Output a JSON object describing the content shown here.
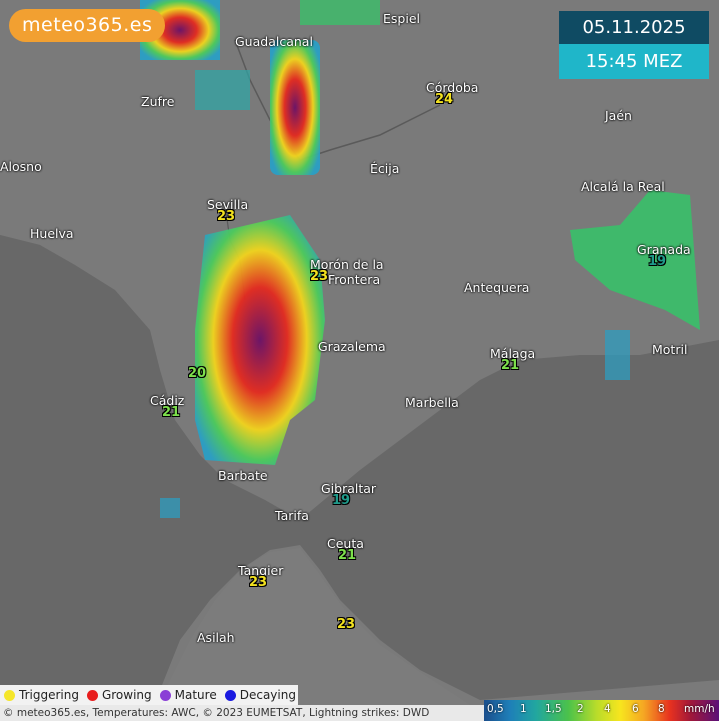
{
  "logo": "meteo365.es",
  "date": "05.11.2025",
  "time": "15:45 MEZ",
  "colors": {
    "land": "#7a7a7a",
    "sea": "#6a6a6a",
    "logo": "#f2a031",
    "date_bg": "#0f4b63",
    "time_bg": "#1fb6c9"
  },
  "cities": [
    {
      "name": "Espiel"
    },
    {
      "name": "Guadalcanal"
    },
    {
      "name": "Córdoba"
    },
    {
      "name": "Zufre"
    },
    {
      "name": "Jaén"
    },
    {
      "name": "Alosno"
    },
    {
      "name": "Écija"
    },
    {
      "name": "Sevilla"
    },
    {
      "name": "Alcalá la Real"
    },
    {
      "name": "Huelva"
    },
    {
      "name": "Granada"
    },
    {
      "name": "Morón de la"
    },
    {
      "name": "Frontera"
    },
    {
      "name": "Antequera"
    },
    {
      "name": "Grazalema"
    },
    {
      "name": "Málaga"
    },
    {
      "name": "Motril"
    },
    {
      "name": "Cádiz"
    },
    {
      "name": "Marbella"
    },
    {
      "name": "Barbate"
    },
    {
      "name": "Gibraltar"
    },
    {
      "name": "Tarifa"
    },
    {
      "name": "Ceuta"
    },
    {
      "name": "Tangier"
    },
    {
      "name": "Asilah"
    }
  ],
  "temps": [
    {
      "value": "24"
    },
    {
      "value": "23"
    },
    {
      "value": "19"
    },
    {
      "value": "23"
    },
    {
      "value": "21"
    },
    {
      "value": "20"
    },
    {
      "value": "21"
    },
    {
      "value": "19"
    },
    {
      "value": "21"
    },
    {
      "value": "23"
    },
    {
      "value": "23"
    }
  ],
  "legend": [
    {
      "label": "Triggering",
      "color": "#f5e62a"
    },
    {
      "label": "Growing",
      "color": "#e81e1e"
    },
    {
      "label": "Mature",
      "color": "#8a3fd6"
    },
    {
      "label": "Decaying",
      "color": "#1a1ae0"
    }
  ],
  "credits": "© meteo365.es, Temperatures: AWC, © 2023 EUMETSAT, Lightning strikes: DWD",
  "scale": {
    "ticks": [
      "0,5",
      "1",
      "1,5",
      "2",
      "4",
      "6",
      "8",
      "mm/h"
    ]
  }
}
